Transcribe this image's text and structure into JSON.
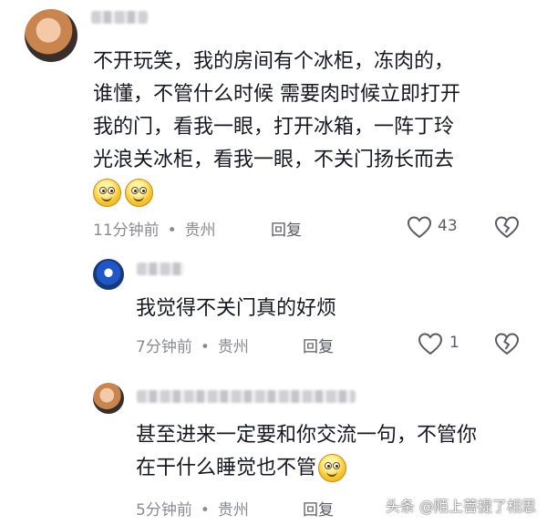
{
  "comments": [
    {
      "lines": [
        "不开玩笑，我的房间有个冰柜，冻肉的，",
        "谁懂，不管什么时候 需要肉时候立即打开",
        "我的门，看我一眼，打开冰箱，一阵丁玲",
        "光浪关冰柜，看我一眼，不关门扬长而去"
      ],
      "emoji_count": 2,
      "time": "11分钟前",
      "location": "贵州",
      "reply_label": "回复",
      "likes": "43"
    },
    {
      "lines": [
        "我觉得不关门真的好烦"
      ],
      "time": "7分钟前",
      "location": "贵州",
      "reply_label": "回复",
      "likes": "1"
    },
    {
      "lines": [
        "甚至进来一定要和你交流一句，不管你",
        "在干什么睡觉也不管"
      ],
      "emoji_count": 1,
      "time": "5分钟前",
      "location": "贵州",
      "reply_label": "回复"
    }
  ],
  "dot": "•",
  "watermark": "头条 @陌上菩提了相思",
  "icons": {
    "like": "heart-outline-icon",
    "dislike": "broken-heart-icon",
    "emoji": "smile-emoji-icon"
  }
}
